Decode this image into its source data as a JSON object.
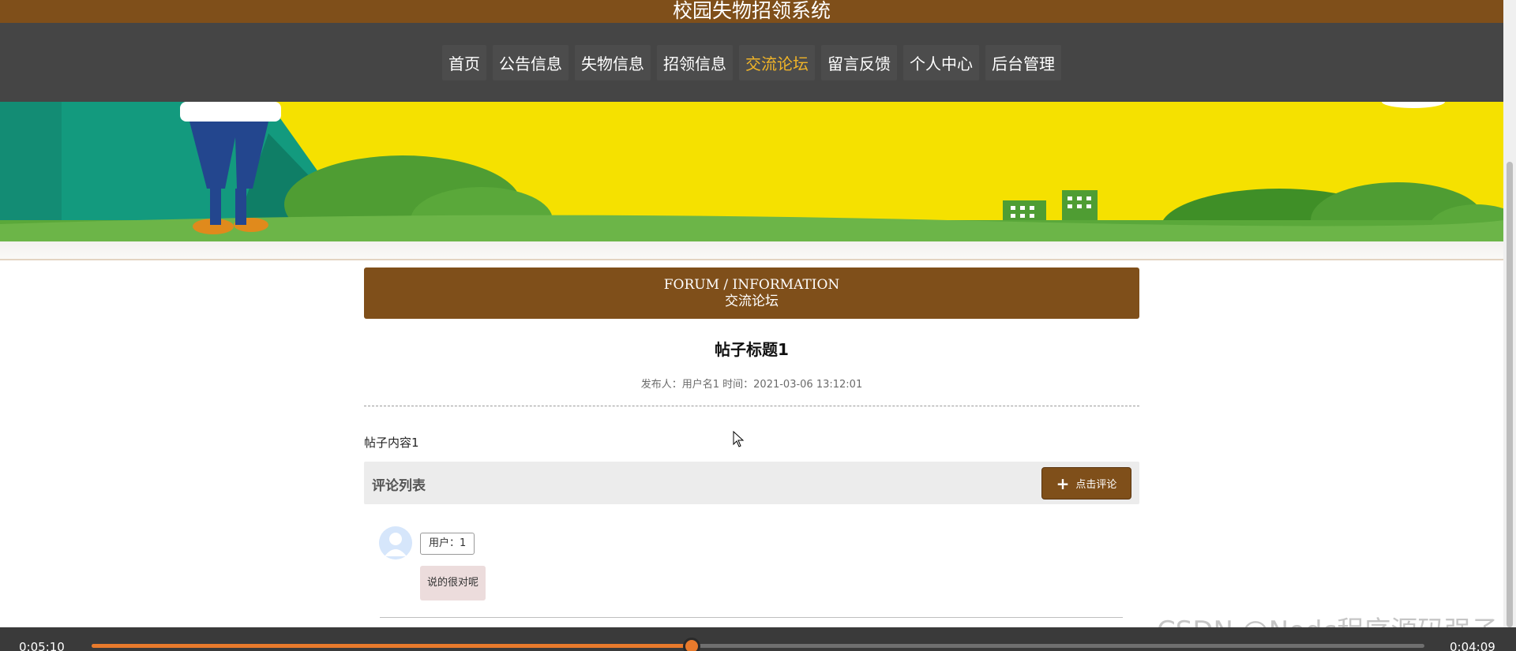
{
  "site": {
    "title": "校园失物招领系统"
  },
  "nav": {
    "items": [
      {
        "label": "首页",
        "active": false
      },
      {
        "label": "公告信息",
        "active": false
      },
      {
        "label": "失物信息",
        "active": false
      },
      {
        "label": "招领信息",
        "active": false
      },
      {
        "label": "交流论坛",
        "active": true
      },
      {
        "label": "留言反馈",
        "active": false
      },
      {
        "label": "个人中心",
        "active": false
      },
      {
        "label": "后台管理",
        "active": false
      }
    ]
  },
  "banner": {
    "slides_total": 3,
    "active_slide": 1
  },
  "section": {
    "title_en": "FORUM / INFORMATION",
    "title_zh": "交流论坛"
  },
  "post": {
    "title": "帖子标题1",
    "meta": "发布人：用户名1 时间：2021-03-06 13:12:01",
    "content": "帖子内容1"
  },
  "comments": {
    "header": "评论列表",
    "add_button_label": "点击评论",
    "add_button_icon": "plus-icon",
    "items": [
      {
        "user": "用户：1",
        "text": "说的很对呢"
      }
    ]
  },
  "watermark": "CSDN @Nodc程序源码强子",
  "player": {
    "current_time": "0:05:10",
    "total_time": "0:04:09",
    "progress_fraction": 0.45
  },
  "colors": {
    "brand_brown": "#7f4f1a",
    "nav_bg": "#454545",
    "nav_active": "#f0b428",
    "banner_yellow": "#f5e100",
    "progress_orange": "#e87a2c"
  }
}
